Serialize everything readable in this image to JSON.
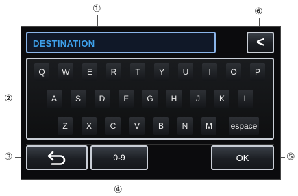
{
  "destination": {
    "value": "DESTINATION"
  },
  "callouts": [
    "①",
    "②",
    "③",
    "④",
    "⑤",
    "⑥"
  ],
  "buttons": {
    "back_label": "<",
    "mode_label": "0-9",
    "ok_label": "OK"
  },
  "keyboard": {
    "row1": [
      "Q",
      "W",
      "E",
      "R",
      "T",
      "Y",
      "U",
      "I",
      "O",
      "P"
    ],
    "row2": [
      "A",
      "S",
      "D",
      "F",
      "G",
      "H",
      "J",
      "K",
      "L"
    ],
    "row3": [
      "Z",
      "X",
      "C",
      "V",
      "B",
      "N",
      "M",
      "espace"
    ]
  },
  "icons": {
    "return": "return-arrow-icon"
  }
}
